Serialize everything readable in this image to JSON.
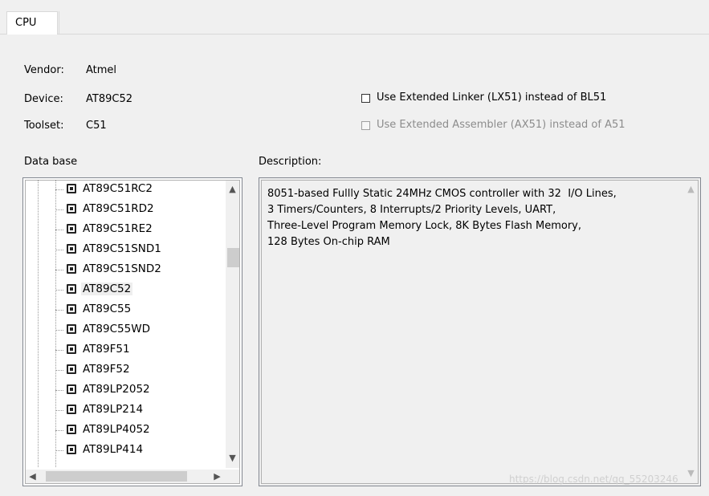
{
  "tab": {
    "label": "CPU"
  },
  "info": {
    "vendor_label": "Vendor:",
    "vendor_value": "Atmel",
    "device_label": "Device:",
    "device_value": "AT89C52",
    "toolset_label": "Toolset:",
    "toolset_value": "C51"
  },
  "options": {
    "lx51_label": "Use Extended Linker (LX51) instead of BL51",
    "lx51_checked": false,
    "ax51_label": "Use Extended Assembler (AX51) instead of A51",
    "ax51_checked": false,
    "ax51_enabled": false
  },
  "database": {
    "label": "Data base",
    "items": [
      "AT89C51RC2",
      "AT89C51RD2",
      "AT89C51RE2",
      "AT89C51SND1",
      "AT89C51SND2",
      "AT89C52",
      "AT89C55",
      "AT89C55WD",
      "AT89F51",
      "AT89F52",
      "AT89LP2052",
      "AT89LP214",
      "AT89LP4052",
      "AT89LP414"
    ],
    "selected": "AT89C52"
  },
  "description": {
    "label": "Description:",
    "text": "8051-based Fullly Static 24MHz CMOS controller with 32  I/O Lines,\n3 Timers/Counters, 8 Interrupts/2 Priority Levels, UART,\nThree-Level Program Memory Lock, 8K Bytes Flash Memory,\n128 Bytes On-chip RAM"
  },
  "watermark": "https://blog.csdn.net/qq_55203246",
  "icons": {
    "scroll_up": "▲",
    "scroll_down": "▼",
    "scroll_left": "◀",
    "scroll_right": "▶",
    "chip": "chip-icon"
  }
}
